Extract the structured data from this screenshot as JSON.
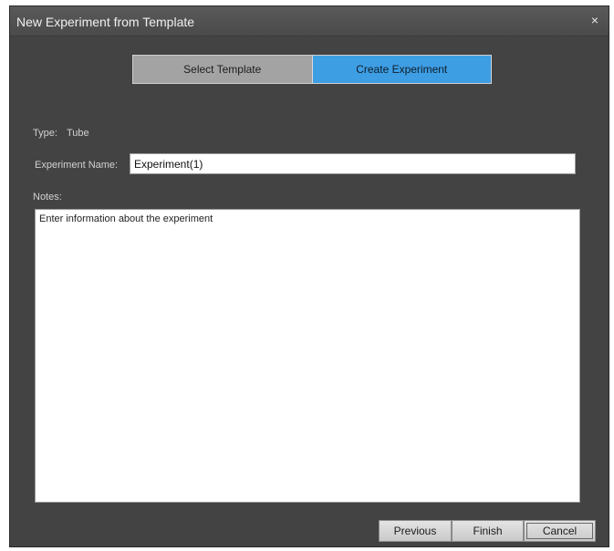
{
  "window": {
    "title": "New Experiment from Template",
    "close_symbol": "×"
  },
  "wizard": {
    "steps": [
      {
        "label": "Select Template",
        "active": false
      },
      {
        "label": "Create Experiment",
        "active": true
      }
    ]
  },
  "form": {
    "type_label": "Type:",
    "type_value": "Tube",
    "name_label": "Experiment Name:",
    "name_value": "Experiment(1)",
    "notes_label": "Notes:",
    "notes_placeholder": "Enter information about the experiment"
  },
  "buttons": {
    "previous": "Previous",
    "finish": "Finish",
    "cancel": "Cancel"
  },
  "colors": {
    "dialog_bg": "#434343",
    "active_step": "#3e9ee4",
    "inactive_step": "#a3a3a3"
  }
}
